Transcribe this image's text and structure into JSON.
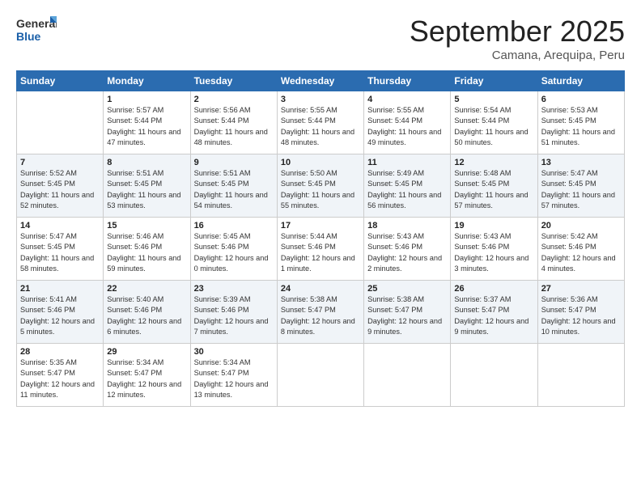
{
  "logo": {
    "general": "General",
    "blue": "Blue"
  },
  "title": "September 2025",
  "subtitle": "Camana, Arequipa, Peru",
  "header_days": [
    "Sunday",
    "Monday",
    "Tuesday",
    "Wednesday",
    "Thursday",
    "Friday",
    "Saturday"
  ],
  "weeks": [
    [
      {
        "day": "",
        "sunrise": "",
        "sunset": "",
        "daylight": ""
      },
      {
        "day": "1",
        "sunrise": "Sunrise: 5:57 AM",
        "sunset": "Sunset: 5:44 PM",
        "daylight": "Daylight: 11 hours and 47 minutes."
      },
      {
        "day": "2",
        "sunrise": "Sunrise: 5:56 AM",
        "sunset": "Sunset: 5:44 PM",
        "daylight": "Daylight: 11 hours and 48 minutes."
      },
      {
        "day": "3",
        "sunrise": "Sunrise: 5:55 AM",
        "sunset": "Sunset: 5:44 PM",
        "daylight": "Daylight: 11 hours and 48 minutes."
      },
      {
        "day": "4",
        "sunrise": "Sunrise: 5:55 AM",
        "sunset": "Sunset: 5:44 PM",
        "daylight": "Daylight: 11 hours and 49 minutes."
      },
      {
        "day": "5",
        "sunrise": "Sunrise: 5:54 AM",
        "sunset": "Sunset: 5:44 PM",
        "daylight": "Daylight: 11 hours and 50 minutes."
      },
      {
        "day": "6",
        "sunrise": "Sunrise: 5:53 AM",
        "sunset": "Sunset: 5:45 PM",
        "daylight": "Daylight: 11 hours and 51 minutes."
      }
    ],
    [
      {
        "day": "7",
        "sunrise": "Sunrise: 5:52 AM",
        "sunset": "Sunset: 5:45 PM",
        "daylight": "Daylight: 11 hours and 52 minutes."
      },
      {
        "day": "8",
        "sunrise": "Sunrise: 5:51 AM",
        "sunset": "Sunset: 5:45 PM",
        "daylight": "Daylight: 11 hours and 53 minutes."
      },
      {
        "day": "9",
        "sunrise": "Sunrise: 5:51 AM",
        "sunset": "Sunset: 5:45 PM",
        "daylight": "Daylight: 11 hours and 54 minutes."
      },
      {
        "day": "10",
        "sunrise": "Sunrise: 5:50 AM",
        "sunset": "Sunset: 5:45 PM",
        "daylight": "Daylight: 11 hours and 55 minutes."
      },
      {
        "day": "11",
        "sunrise": "Sunrise: 5:49 AM",
        "sunset": "Sunset: 5:45 PM",
        "daylight": "Daylight: 11 hours and 56 minutes."
      },
      {
        "day": "12",
        "sunrise": "Sunrise: 5:48 AM",
        "sunset": "Sunset: 5:45 PM",
        "daylight": "Daylight: 11 hours and 57 minutes."
      },
      {
        "day": "13",
        "sunrise": "Sunrise: 5:47 AM",
        "sunset": "Sunset: 5:45 PM",
        "daylight": "Daylight: 11 hours and 57 minutes."
      }
    ],
    [
      {
        "day": "14",
        "sunrise": "Sunrise: 5:47 AM",
        "sunset": "Sunset: 5:45 PM",
        "daylight": "Daylight: 11 hours and 58 minutes."
      },
      {
        "day": "15",
        "sunrise": "Sunrise: 5:46 AM",
        "sunset": "Sunset: 5:46 PM",
        "daylight": "Daylight: 11 hours and 59 minutes."
      },
      {
        "day": "16",
        "sunrise": "Sunrise: 5:45 AM",
        "sunset": "Sunset: 5:46 PM",
        "daylight": "Daylight: 12 hours and 0 minutes."
      },
      {
        "day": "17",
        "sunrise": "Sunrise: 5:44 AM",
        "sunset": "Sunset: 5:46 PM",
        "daylight": "Daylight: 12 hours and 1 minute."
      },
      {
        "day": "18",
        "sunrise": "Sunrise: 5:43 AM",
        "sunset": "Sunset: 5:46 PM",
        "daylight": "Daylight: 12 hours and 2 minutes."
      },
      {
        "day": "19",
        "sunrise": "Sunrise: 5:43 AM",
        "sunset": "Sunset: 5:46 PM",
        "daylight": "Daylight: 12 hours and 3 minutes."
      },
      {
        "day": "20",
        "sunrise": "Sunrise: 5:42 AM",
        "sunset": "Sunset: 5:46 PM",
        "daylight": "Daylight: 12 hours and 4 minutes."
      }
    ],
    [
      {
        "day": "21",
        "sunrise": "Sunrise: 5:41 AM",
        "sunset": "Sunset: 5:46 PM",
        "daylight": "Daylight: 12 hours and 5 minutes."
      },
      {
        "day": "22",
        "sunrise": "Sunrise: 5:40 AM",
        "sunset": "Sunset: 5:46 PM",
        "daylight": "Daylight: 12 hours and 6 minutes."
      },
      {
        "day": "23",
        "sunrise": "Sunrise: 5:39 AM",
        "sunset": "Sunset: 5:46 PM",
        "daylight": "Daylight: 12 hours and 7 minutes."
      },
      {
        "day": "24",
        "sunrise": "Sunrise: 5:38 AM",
        "sunset": "Sunset: 5:47 PM",
        "daylight": "Daylight: 12 hours and 8 minutes."
      },
      {
        "day": "25",
        "sunrise": "Sunrise: 5:38 AM",
        "sunset": "Sunset: 5:47 PM",
        "daylight": "Daylight: 12 hours and 9 minutes."
      },
      {
        "day": "26",
        "sunrise": "Sunrise: 5:37 AM",
        "sunset": "Sunset: 5:47 PM",
        "daylight": "Daylight: 12 hours and 9 minutes."
      },
      {
        "day": "27",
        "sunrise": "Sunrise: 5:36 AM",
        "sunset": "Sunset: 5:47 PM",
        "daylight": "Daylight: 12 hours and 10 minutes."
      }
    ],
    [
      {
        "day": "28",
        "sunrise": "Sunrise: 5:35 AM",
        "sunset": "Sunset: 5:47 PM",
        "daylight": "Daylight: 12 hours and 11 minutes."
      },
      {
        "day": "29",
        "sunrise": "Sunrise: 5:34 AM",
        "sunset": "Sunset: 5:47 PM",
        "daylight": "Daylight: 12 hours and 12 minutes."
      },
      {
        "day": "30",
        "sunrise": "Sunrise: 5:34 AM",
        "sunset": "Sunset: 5:47 PM",
        "daylight": "Daylight: 12 hours and 13 minutes."
      },
      {
        "day": "",
        "sunrise": "",
        "sunset": "",
        "daylight": ""
      },
      {
        "day": "",
        "sunrise": "",
        "sunset": "",
        "daylight": ""
      },
      {
        "day": "",
        "sunrise": "",
        "sunset": "",
        "daylight": ""
      },
      {
        "day": "",
        "sunrise": "",
        "sunset": "",
        "daylight": ""
      }
    ]
  ]
}
